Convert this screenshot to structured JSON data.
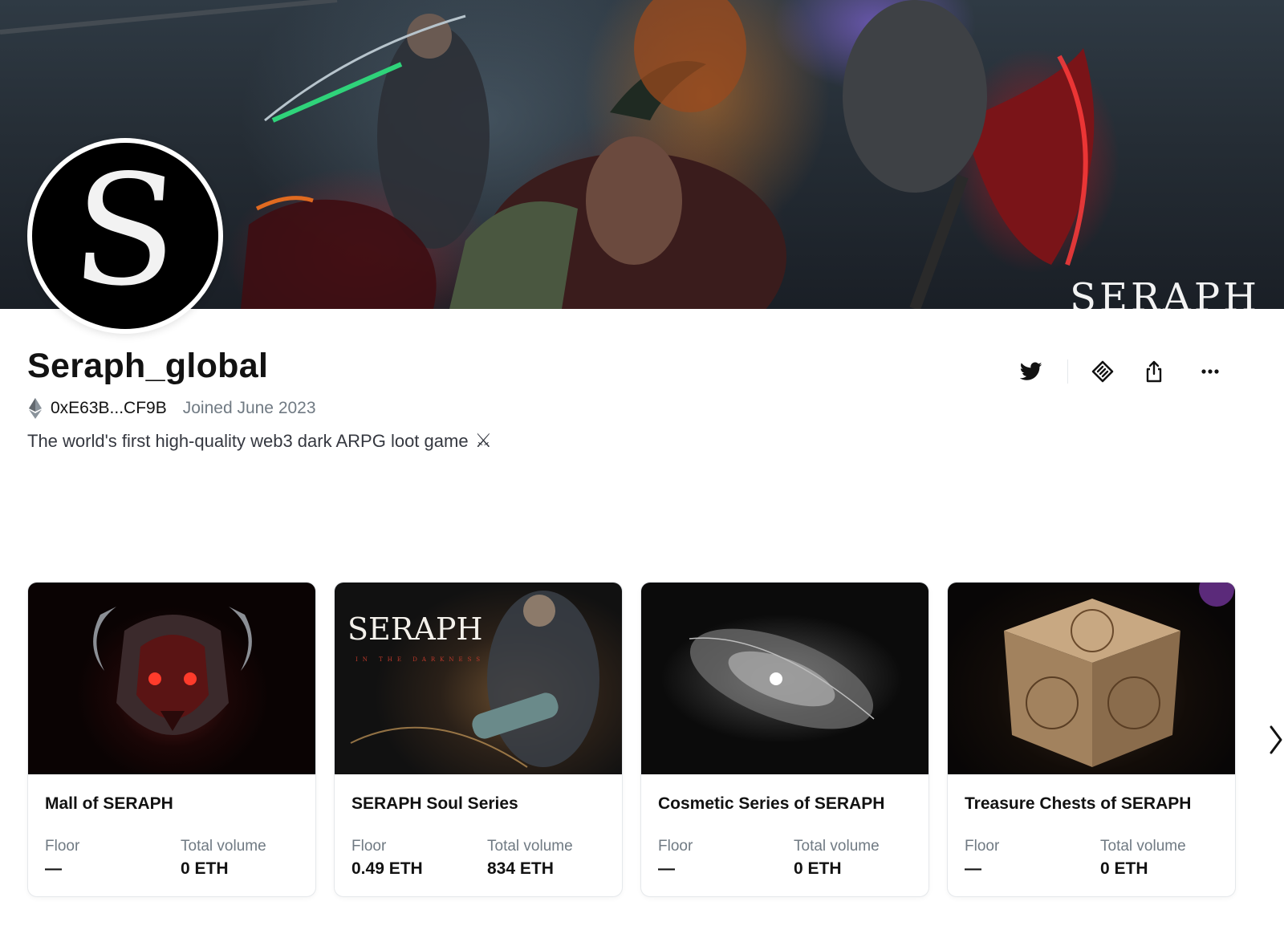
{
  "banner": {
    "watermark": "SERAPH"
  },
  "profile": {
    "avatar_letter": "S",
    "name": "Seraph_global",
    "chain_icon": "ethereum-icon",
    "address": "0xE63B...CF9B",
    "joined": "Joined June 2023",
    "bio": "The world's first high-quality web3 dark ARPG loot game",
    "bio_emoji": "⚔"
  },
  "actions": [
    {
      "name": "twitter-icon"
    },
    {
      "name": "offer-icon"
    },
    {
      "name": "share-icon"
    },
    {
      "name": "more-icon"
    }
  ],
  "collections": [
    {
      "title": "Mall of SERAPH",
      "floor_label": "Floor",
      "floor": "—",
      "volume_label": "Total volume",
      "volume": "0 ETH"
    },
    {
      "title": "SERAPH Soul Series",
      "floor_label": "Floor",
      "floor": "0.49 ETH",
      "volume_label": "Total volume",
      "volume": "834 ETH",
      "image_text": "SERAPH",
      "image_subtext": "IN THE DARKNESS"
    },
    {
      "title": "Cosmetic Series of SERAPH",
      "floor_label": "Floor",
      "floor": "—",
      "volume_label": "Total volume",
      "volume": "0 ETH"
    },
    {
      "title": "Treasure Chests of SERAPH",
      "floor_label": "Floor",
      "floor": "—",
      "volume_label": "Total volume",
      "volume": "0 ETH"
    }
  ],
  "colors": {
    "text_primary": "#121212",
    "text_secondary": "#707a83",
    "border": "#e5e8eb"
  }
}
